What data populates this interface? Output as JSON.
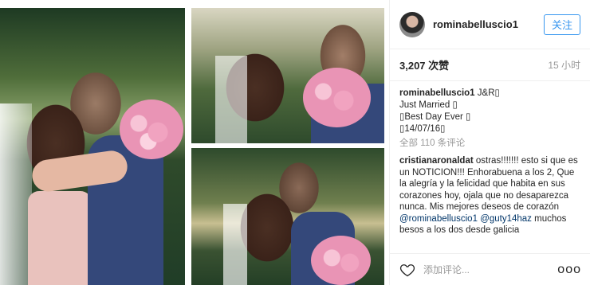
{
  "post": {
    "images": [
      {
        "name": "wedding-photo-kiss"
      },
      {
        "name": "wedding-photo-hug-top"
      },
      {
        "name": "wedding-photo-hug-bottom"
      }
    ]
  },
  "header": {
    "username": "rominabelluscio1",
    "follow_label": "关注"
  },
  "meta": {
    "likes": "3,207 次赞",
    "time": "15 小时"
  },
  "caption": {
    "username": "rominabelluscio1",
    "first_line": "J&R▯",
    "lines": [
      "Just Married ▯",
      "▯Best Day Ever ▯",
      "▯14/07/16▯"
    ],
    "view_all": "全部 110 条评论"
  },
  "comment": {
    "username": "cristianaronaldat",
    "text_1": "ostras!!!!!!! esto si que es un NOTICION!!! Enhorabuena a los 2, Que la alegría y la felicidad que habita en sus corazones hoy, ojala que no desaparezca nunca. Mis mejores deseos de corazón",
    "mention_1": "@rominabelluscio1",
    "mention_2": "@guty14haz",
    "text_2": "muchos besos a los dos desde galicia"
  },
  "footer": {
    "add_comment_placeholder": "添加评论...",
    "more_label": "ooo",
    "heart_icon": "heart-icon"
  },
  "colors": {
    "accent": "#3897f0",
    "text": "#262626",
    "muted": "#999999",
    "mention": "#003569"
  }
}
